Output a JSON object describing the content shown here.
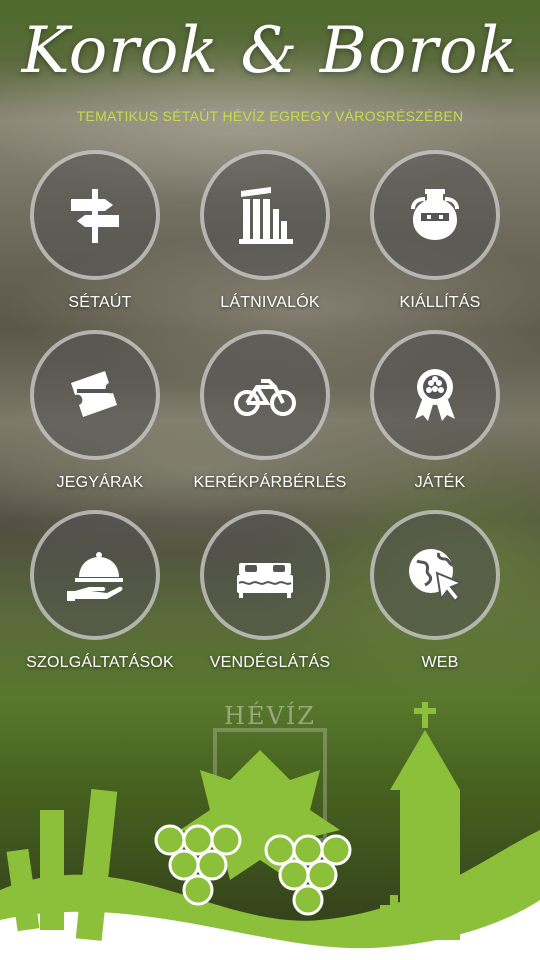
{
  "header": {
    "title": "Korok & Borok",
    "subtitle": "TEMATIKUS SÉTAÚT HÉVÍZ EGREGY VÁROSRÉSZÉBEN"
  },
  "menu": [
    {
      "label": "SÉTAÚT",
      "icon": "signpost-icon"
    },
    {
      "label": "LÁTNIVALÓK",
      "icon": "ruins-icon"
    },
    {
      "label": "KIÁLLÍTÁS",
      "icon": "amphora-icon"
    },
    {
      "label": "JEGYÁRAK",
      "icon": "tickets-icon"
    },
    {
      "label": "KERÉKPÁRBÉRLÉS",
      "icon": "bicycle-icon"
    },
    {
      "label": "JÁTÉK",
      "icon": "award-ribbon-icon"
    },
    {
      "label": "SZOLGÁLTATÁSOK",
      "icon": "cloche-icon"
    },
    {
      "label": "VENDÉGLÁTÁS",
      "icon": "bed-icon"
    },
    {
      "label": "WEB",
      "icon": "globe-cursor-icon"
    }
  ],
  "footer": {
    "town_name": "HÉVÍZ"
  },
  "colors": {
    "accent": "#c6dd4a",
    "green": "#8cbf3a",
    "text": "#ffffff"
  }
}
